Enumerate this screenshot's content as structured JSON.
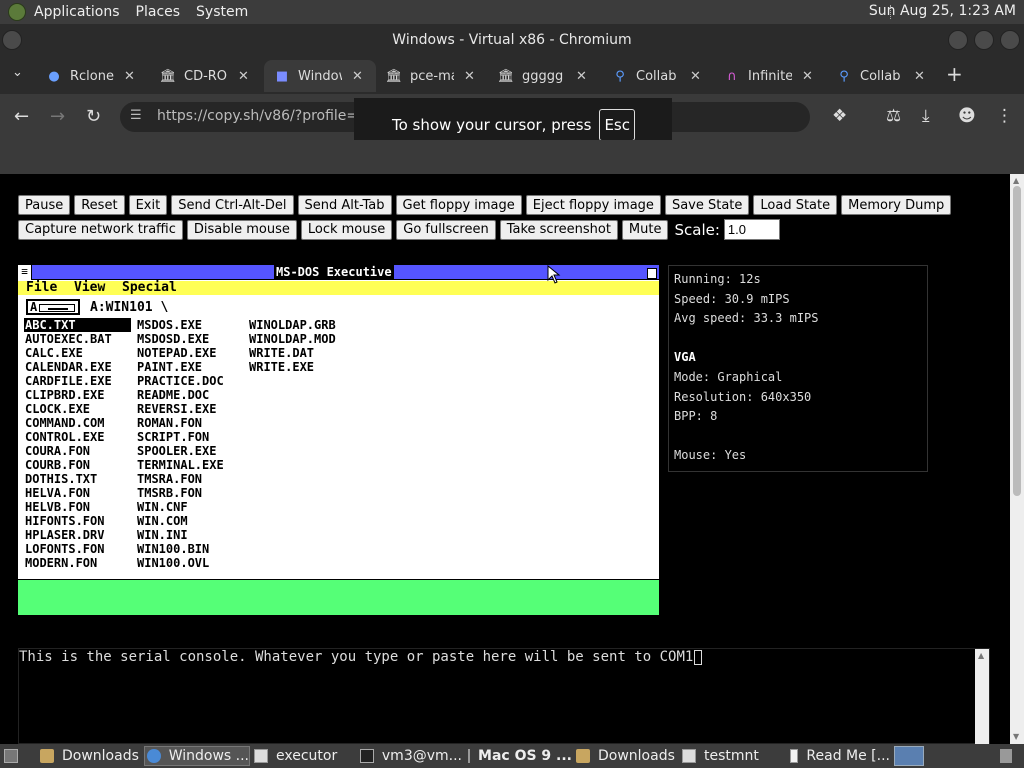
{
  "top_panel": {
    "menus": [
      "Applications",
      "Places",
      "System"
    ],
    "clock": "Sun Aug 25,  1:23 AM"
  },
  "window": {
    "title": "Windows - Virtual x86 - Chromium"
  },
  "tabs": [
    {
      "label": "Rclone",
      "icon": "rclone-icon"
    },
    {
      "label": "CD-ROM",
      "icon": "archive-icon"
    },
    {
      "label": "Windows",
      "icon": "v86-icon",
      "active": true
    },
    {
      "label": "pce-ma",
      "icon": "archive-icon"
    },
    {
      "label": "ggggg",
      "icon": "archive-icon"
    },
    {
      "label": "Collab",
      "icon": "search-icon"
    },
    {
      "label": "Infinite",
      "icon": "infinite-icon"
    },
    {
      "label": "Collab",
      "icon": "search-icon"
    }
  ],
  "address_bar": {
    "url": "https://copy.sh/v86/?profile=windows"
  },
  "cursor_tooltip": {
    "text": "To show your cursor, press",
    "key": "Esc"
  },
  "controls": {
    "row1": [
      "Pause",
      "Reset",
      "Exit",
      "Send Ctrl-Alt-Del",
      "Send Alt-Tab",
      "Get floppy image",
      "Eject floppy image",
      "Save State",
      "Load State",
      "Memory Dump"
    ],
    "row2": [
      "Capture network traffic",
      "Disable mouse",
      "Lock mouse",
      "Go fullscreen",
      "Take screenshot",
      "Mute"
    ],
    "scale_label": "Scale:",
    "scale_value": "1.0"
  },
  "msdos": {
    "title": "MS-DOS Executive",
    "menus": [
      "File",
      "View",
      "Special"
    ],
    "drive": "A",
    "path": "A:WIN101 \\",
    "columns": [
      [
        "ABC.TXT",
        "AUTOEXEC.BAT",
        "CALC.EXE",
        "CALENDAR.EXE",
        "CARDFILE.EXE",
        "CLIPBRD.EXE",
        "CLOCK.EXE",
        "COMMAND.COM",
        "CONTROL.EXE",
        "COURA.FON",
        "COURB.FON",
        "DOTHIS.TXT",
        "HELVA.FON",
        "HELVB.FON",
        "HIFONTS.FON",
        "HPLASER.DRV",
        "LOFONTS.FON",
        "MODERN.FON"
      ],
      [
        "MSDOS.EXE",
        "MSDOSD.EXE",
        "NOTEPAD.EXE",
        "PAINT.EXE",
        "PRACTICE.DOC",
        "README.DOC",
        "REVERSI.EXE",
        "ROMAN.FON",
        "SCRIPT.FON",
        "SPOOLER.EXE",
        "TERMINAL.EXE",
        "TMSRA.FON",
        "TMSRB.FON",
        "WIN.CNF",
        "WIN.COM",
        "WIN.INI",
        "WIN100.BIN",
        "WIN100.OVL"
      ],
      [
        "WINOLDAP.GRB",
        "WINOLDAP.MOD",
        "WRITE.DAT",
        "WRITE.EXE"
      ]
    ],
    "selected": "ABC.TXT"
  },
  "status": {
    "running": "Running: 12s",
    "speed": "Speed: 30.9 mIPS",
    "avg_speed": "Avg speed: 33.3 mIPS",
    "vga_heading": "VGA",
    "mode": "Mode: Graphical",
    "resolution": "Resolution: 640x350",
    "bpp": "BPP: 8",
    "mouse": "Mouse: Yes"
  },
  "serial": {
    "text": "This is the serial console. Whatever you type or paste here will be sent to COM1"
  },
  "taskbar": [
    {
      "label": "Downloads",
      "icon": "folder-icon"
    },
    {
      "label": "Windows ...",
      "icon": "chromium-icon"
    },
    {
      "label": "executor",
      "icon": "window-icon"
    },
    {
      "label": "vm3@vm...",
      "icon": "terminal-icon"
    },
    {
      "label": "Mac OS 9 ...",
      "icon": "window-icon",
      "bold": true
    },
    {
      "label": "Downloads",
      "icon": "folder-icon"
    },
    {
      "label": "testmnt",
      "icon": "window-icon"
    },
    {
      "label": "Read Me [...",
      "icon": "document-icon"
    }
  ],
  "colors": {
    "msdos_titlebar": "#5555ff",
    "msdos_menubar": "#ffff55",
    "msdos_bottom": "#55ff77"
  }
}
